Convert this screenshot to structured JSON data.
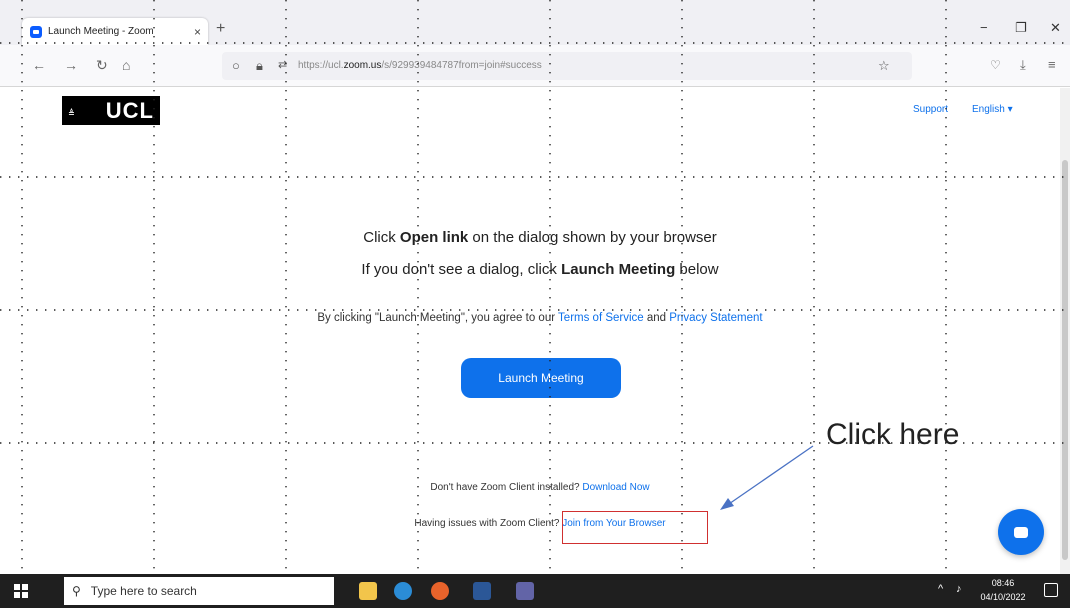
{
  "browser": {
    "tab_title": "Launch Meeting - Zoom",
    "tab_close": "×",
    "new_tab": "+",
    "url_prefix": "https://ucl.",
    "url_domain": "zoom.us",
    "url_suffix": "/s/929939484787from=join#success",
    "minimize": "−",
    "maximize": "❐",
    "close": "✕"
  },
  "site": {
    "logo_text": "UCL",
    "logo_small": "≜",
    "support": "Support",
    "language": "English ▾"
  },
  "main": {
    "line1_pre": "Click ",
    "line1_bold": "Open link",
    "line1_post": " on the dialog shown by your browser",
    "line2_pre": "If you don't see a dialog, click ",
    "line2_bold": "Launch Meeting",
    "line2_post": " below",
    "agree_pre": "By clicking \"Launch Meeting\", you agree to our ",
    "terms": "Terms of Service",
    "agree_mid": " and ",
    "privacy": "Privacy Statement",
    "launch_button": "Launch Meeting",
    "download_pre": "Don't have Zoom Client installed? ",
    "download_link": "Download Now",
    "issues_pre": "Having issues with Zoom Client? ",
    "browser_link": "Join from Your Browser"
  },
  "annotation": {
    "text": "Click here",
    "box_color": "#d03030",
    "arrow_color": "#4a72c4"
  },
  "taskbar": {
    "search_placeholder": "Type here to search",
    "time": "08:46",
    "date": "04/10/2022"
  },
  "colors": {
    "accent": "#0e71eb",
    "taskbar": "#1f1f1f"
  }
}
